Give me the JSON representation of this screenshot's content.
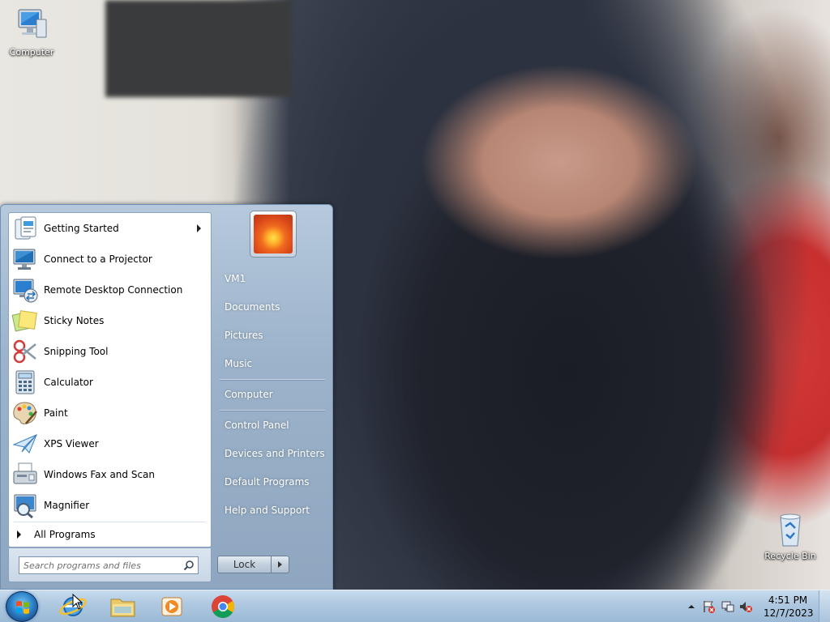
{
  "desktop": {
    "icons": [
      {
        "label": "Computer",
        "icon": "computer-icon"
      },
      {
        "label": "Recycle Bin",
        "icon": "recycle-bin-icon"
      }
    ]
  },
  "start_menu": {
    "programs": [
      {
        "label": "Getting Started",
        "icon": "getting-started-icon",
        "has_submenu": true
      },
      {
        "label": "Connect to a Projector",
        "icon": "projector-icon"
      },
      {
        "label": "Remote Desktop Connection",
        "icon": "remote-desktop-icon"
      },
      {
        "label": "Sticky Notes",
        "icon": "sticky-notes-icon"
      },
      {
        "label": "Snipping Tool",
        "icon": "scissors-icon"
      },
      {
        "label": "Calculator",
        "icon": "calculator-icon"
      },
      {
        "label": "Paint",
        "icon": "paint-palette-icon"
      },
      {
        "label": "XPS Viewer",
        "icon": "paper-plane-icon"
      },
      {
        "label": "Windows Fax and Scan",
        "icon": "fax-icon"
      },
      {
        "label": "Magnifier",
        "icon": "magnifier-icon"
      }
    ],
    "all_programs": "All Programs",
    "search_placeholder": "Search programs and files",
    "right_items": [
      {
        "label": "VM1"
      },
      {
        "label": "Documents"
      },
      {
        "label": "Pictures"
      },
      {
        "label": "Music"
      },
      {
        "label": "Computer"
      },
      {
        "label": "Control Panel"
      },
      {
        "label": "Devices and Printers"
      },
      {
        "label": "Default Programs"
      },
      {
        "label": "Help and Support"
      }
    ],
    "lock_label": "Lock"
  },
  "taskbar": {
    "pinned": [
      {
        "name": "internet-explorer-icon"
      },
      {
        "name": "file-explorer-icon"
      },
      {
        "name": "media-player-icon"
      },
      {
        "name": "chrome-icon"
      }
    ],
    "clock": {
      "time": "4:51 PM",
      "date": "12/7/2023"
    },
    "tray_icons": [
      "show-hidden-icons",
      "action-center-icon",
      "network-icon",
      "volume-muted-icon"
    ]
  },
  "colors": {
    "accent": "#2f86cc",
    "taskbar": "#aec8e0"
  }
}
